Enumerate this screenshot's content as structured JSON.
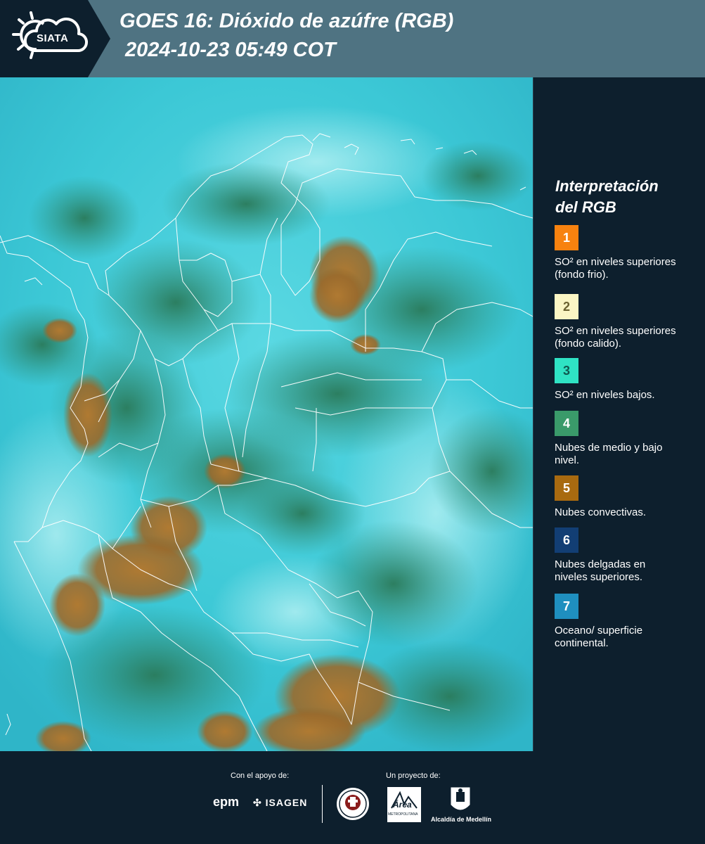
{
  "header": {
    "logo_text": "SIATA",
    "title_line1": "GOES 16: Dióxido de azúfre (RGB)",
    "title_line2": "2024-10-23 05:49 COT"
  },
  "legend": {
    "title_line1": "Interpretación",
    "title_line2": "del RGB",
    "items": [
      {
        "number": "1",
        "color": "#f7820f",
        "num_color": "#ffffff",
        "label": "SO² en niveles superiores (fondo frio)."
      },
      {
        "number": "2",
        "color": "#fbf6c4",
        "num_color": "#6b6230",
        "label": "SO² en niveles superiores (fondo calido)."
      },
      {
        "number": "3",
        "color": "#2fe3c4",
        "num_color": "#0f5a50",
        "label": "SO² en niveles bajos."
      },
      {
        "number": "4",
        "color": "#3a9a6a",
        "num_color": "#ffffff",
        "label": "Nubes de medio y bajo nivel."
      },
      {
        "number": "5",
        "color": "#a86a10",
        "num_color": "#ffffff",
        "label": "Nubes convectivas."
      },
      {
        "number": "6",
        "color": "#123e74",
        "num_color": "#ffffff",
        "label": "Nubes delgadas en niveles superiores."
      },
      {
        "number": "7",
        "color": "#1f8fbf",
        "num_color": "#ffffff",
        "label": "Oceano/ superficie continental."
      }
    ]
  },
  "footer": {
    "support_label": "Con el apoyo de:",
    "project_label": "Un proyecto de:",
    "sponsor1": "epm",
    "sponsor2": "ISAGEN",
    "partner_area": "Área",
    "partner_area_sub": "METROPOLITANA",
    "partner_alcaldia": "Alcaldía de Medellín"
  },
  "colors": {
    "header_bg": "#4f7382",
    "page_bg": "#0d1f2d",
    "map_cyan": "#44d0dc",
    "cloud_green": "#2f8a6a",
    "convective_brown": "#a8742a"
  }
}
